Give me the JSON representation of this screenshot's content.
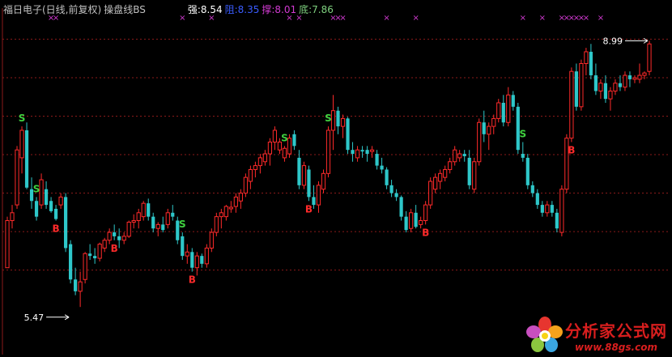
{
  "header": {
    "title": "福日电子(日线,前复权)",
    "indicator_name": "操盘线BS",
    "strong_label": "强:",
    "strong_value": "8.54",
    "resist_label": "阻:",
    "resist_value": "8.35",
    "support_label": "撑:",
    "support_value": "8.01",
    "bottom_label": "底:",
    "bottom_value": "7.86"
  },
  "colors": {
    "background": "#000000",
    "up": "#ff2a2a",
    "down": "#2ec7c9",
    "signal_s": "#3fd13f",
    "signal_b": "#ff2a2a",
    "x_marker": "#d23ad2",
    "grid": "#8b1a1a",
    "title": "#c0c0c0",
    "indicator": "#c0c0c0",
    "strong": "#ffffff",
    "resist": "#3a5cff",
    "support": "#d23ad2",
    "bottom": "#7fd17f"
  },
  "watermark": {
    "text": "分析家公式网",
    "url": "www.88gs.com",
    "logo_icon": "flower-logo-icon"
  },
  "chart_data": {
    "type": "candlestick",
    "ylim": [
      5.2,
      9.2
    ],
    "grid_levels": [
      6.07,
      6.56,
      7.05,
      7.54,
      8.03,
      8.52,
      9.01
    ],
    "candles": [
      [
        6.1,
        6.75,
        6.1,
        6.7
      ],
      [
        6.7,
        6.9,
        6.6,
        6.8
      ],
      [
        6.9,
        7.65,
        6.85,
        7.6
      ],
      [
        7.5,
        7.9,
        7.3,
        7.85
      ],
      [
        7.85,
        7.95,
        7.1,
        7.12
      ],
      [
        7.1,
        7.25,
        6.85,
        6.95
      ],
      [
        6.95,
        7.0,
        6.7,
        6.75
      ],
      [
        6.9,
        7.3,
        6.85,
        7.22
      ],
      [
        7.1,
        7.2,
        6.85,
        6.9
      ],
      [
        6.95,
        7.0,
        6.8,
        6.82
      ],
      [
        6.85,
        6.9,
        6.7,
        6.72
      ],
      [
        6.9,
        7.05,
        6.85,
        7.0
      ],
      [
        7.0,
        7.05,
        6.3,
        6.35
      ],
      [
        6.4,
        6.45,
        5.9,
        5.95
      ],
      [
        5.95,
        6.1,
        5.75,
        5.8
      ],
      [
        5.8,
        6.05,
        5.6,
        5.92
      ],
      [
        5.95,
        6.3,
        5.9,
        6.28
      ],
      [
        6.28,
        6.4,
        6.2,
        6.25
      ],
      [
        6.25,
        6.35,
        6.15,
        6.22
      ],
      [
        6.22,
        6.42,
        6.18,
        6.4
      ],
      [
        6.35,
        6.48,
        6.3,
        6.45
      ],
      [
        6.45,
        6.6,
        6.4,
        6.55
      ],
      [
        6.55,
        6.65,
        6.45,
        6.5
      ],
      [
        6.5,
        6.6,
        6.35,
        6.45
      ],
      [
        6.45,
        6.55,
        6.4,
        6.5
      ],
      [
        6.5,
        6.7,
        6.48,
        6.68
      ],
      [
        6.68,
        6.78,
        6.6,
        6.7
      ],
      [
        6.7,
        6.85,
        6.6,
        6.8
      ],
      [
        6.75,
        6.95,
        6.7,
        6.92
      ],
      [
        6.92,
        6.98,
        6.7,
        6.75
      ],
      [
        6.75,
        6.8,
        6.55,
        6.6
      ],
      [
        6.6,
        6.68,
        6.5,
        6.65
      ],
      [
        6.65,
        6.75,
        6.55,
        6.58
      ],
      [
        6.65,
        6.85,
        6.6,
        6.8
      ],
      [
        6.8,
        6.9,
        6.7,
        6.75
      ],
      [
        6.7,
        6.75,
        6.4,
        6.45
      ],
      [
        6.5,
        6.55,
        6.2,
        6.25
      ],
      [
        6.25,
        6.4,
        6.15,
        6.3
      ],
      [
        6.3,
        6.35,
        6.05,
        6.1
      ],
      [
        6.1,
        6.3,
        6.0,
        6.25
      ],
      [
        6.25,
        6.28,
        6.1,
        6.15
      ],
      [
        6.15,
        6.4,
        6.1,
        6.35
      ],
      [
        6.35,
        6.6,
        6.3,
        6.55
      ],
      [
        6.55,
        6.8,
        6.5,
        6.75
      ],
      [
        6.75,
        6.85,
        6.6,
        6.8
      ],
      [
        6.75,
        6.9,
        6.7,
        6.88
      ],
      [
        6.85,
        6.95,
        6.8,
        6.87
      ],
      [
        6.88,
        7.05,
        6.8,
        7.0
      ],
      [
        6.95,
        7.1,
        6.85,
        7.05
      ],
      [
        7.05,
        7.3,
        7.0,
        7.25
      ],
      [
        7.2,
        7.4,
        7.1,
        7.35
      ],
      [
        7.35,
        7.45,
        7.25,
        7.4
      ],
      [
        7.4,
        7.55,
        7.3,
        7.5
      ],
      [
        7.45,
        7.6,
        7.4,
        7.55
      ],
      [
        7.55,
        7.75,
        7.4,
        7.7
      ],
      [
        7.7,
        7.9,
        7.6,
        7.85
      ],
      [
        7.6,
        7.75,
        7.55,
        7.7
      ],
      [
        7.5,
        7.65,
        7.45,
        7.62
      ],
      [
        7.55,
        7.8,
        7.5,
        7.75
      ],
      [
        7.8,
        7.85,
        7.6,
        7.65
      ],
      [
        7.5,
        7.6,
        7.1,
        7.15
      ],
      [
        7.15,
        7.45,
        7.1,
        7.4
      ],
      [
        7.35,
        7.4,
        6.95,
        7.0
      ],
      [
        7.0,
        7.15,
        6.85,
        6.9
      ],
      [
        6.9,
        7.2,
        6.8,
        7.15
      ],
      [
        7.1,
        7.35,
        7.05,
        7.3
      ],
      [
        7.3,
        7.9,
        7.25,
        7.85
      ],
      [
        7.85,
        8.3,
        7.6,
        8.1
      ],
      [
        8.1,
        8.15,
        7.8,
        7.9
      ],
      [
        7.9,
        8.05,
        7.75,
        8.0
      ],
      [
        8.0,
        8.02,
        7.55,
        7.6
      ],
      [
        7.6,
        7.7,
        7.45,
        7.55
      ],
      [
        7.5,
        7.65,
        7.45,
        7.6
      ],
      [
        7.6,
        7.65,
        7.5,
        7.58
      ],
      [
        7.6,
        7.65,
        7.45,
        7.55
      ],
      [
        7.58,
        7.65,
        7.5,
        7.6
      ],
      [
        7.55,
        7.6,
        7.35,
        7.4
      ],
      [
        7.4,
        7.5,
        7.3,
        7.35
      ],
      [
        7.35,
        7.38,
        7.1,
        7.15
      ],
      [
        7.15,
        7.22,
        7.0,
        7.05
      ],
      [
        7.05,
        7.1,
        6.95,
        7.0
      ],
      [
        7.0,
        7.02,
        6.7,
        6.75
      ],
      [
        6.75,
        6.82,
        6.55,
        6.58
      ],
      [
        6.6,
        6.85,
        6.55,
        6.8
      ],
      [
        6.8,
        6.9,
        6.6,
        6.62
      ],
      [
        6.65,
        6.75,
        6.6,
        6.7
      ],
      [
        6.7,
        6.95,
        6.65,
        6.9
      ],
      [
        6.9,
        7.25,
        6.85,
        7.2
      ],
      [
        7.1,
        7.3,
        7.05,
        7.25
      ],
      [
        7.2,
        7.35,
        7.1,
        7.3
      ],
      [
        7.25,
        7.4,
        7.2,
        7.35
      ],
      [
        7.35,
        7.5,
        7.3,
        7.45
      ],
      [
        7.45,
        7.65,
        7.4,
        7.6
      ],
      [
        7.5,
        7.6,
        7.45,
        7.55
      ],
      [
        7.55,
        7.6,
        7.45,
        7.52
      ],
      [
        7.5,
        7.6,
        7.1,
        7.15
      ],
      [
        7.1,
        7.5,
        7.05,
        7.45
      ],
      [
        7.45,
        8.0,
        7.4,
        7.95
      ],
      [
        7.95,
        8.1,
        7.7,
        7.8
      ],
      [
        7.8,
        7.95,
        7.6,
        7.9
      ],
      [
        7.9,
        8.05,
        7.8,
        8.0
      ],
      [
        8.0,
        8.25,
        7.95,
        8.2
      ],
      [
        8.2,
        8.3,
        7.9,
        7.95
      ],
      [
        7.95,
        8.4,
        7.9,
        8.3
      ],
      [
        8.3,
        8.35,
        8.1,
        8.15
      ],
      [
        8.15,
        8.2,
        7.55,
        7.6
      ],
      [
        7.55,
        7.7,
        7.45,
        7.5
      ],
      [
        7.5,
        7.55,
        7.1,
        7.15
      ],
      [
        7.15,
        7.2,
        7.0,
        7.05
      ],
      [
        7.05,
        7.1,
        6.85,
        6.9
      ],
      [
        6.9,
        6.95,
        6.75,
        6.8
      ],
      [
        6.8,
        6.95,
        6.75,
        6.9
      ],
      [
        6.9,
        6.95,
        6.75,
        6.8
      ],
      [
        6.8,
        6.85,
        6.55,
        6.6
      ],
      [
        6.55,
        7.15,
        6.5,
        7.1
      ],
      [
        7.1,
        7.8,
        7.05,
        7.75
      ],
      [
        7.75,
        8.65,
        7.7,
        8.6
      ],
      [
        8.6,
        8.7,
        8.1,
        8.15
      ],
      [
        8.15,
        8.75,
        8.1,
        8.7
      ],
      [
        8.7,
        8.9,
        8.55,
        8.85
      ],
      [
        8.85,
        8.95,
        8.5,
        8.55
      ],
      [
        8.55,
        8.7,
        8.3,
        8.35
      ],
      [
        8.35,
        8.5,
        8.25,
        8.45
      ],
      [
        8.45,
        8.55,
        8.2,
        8.25
      ],
      [
        8.25,
        8.4,
        8.1,
        8.35
      ],
      [
        8.35,
        8.5,
        8.3,
        8.45
      ],
      [
        8.45,
        8.55,
        8.35,
        8.4
      ],
      [
        8.4,
        8.6,
        8.35,
        8.55
      ],
      [
        8.55,
        8.6,
        8.4,
        8.5
      ],
      [
        8.5,
        8.55,
        8.45,
        8.52
      ],
      [
        8.5,
        8.7,
        8.45,
        8.55
      ],
      [
        8.55,
        8.6,
        8.5,
        8.58
      ],
      [
        8.6,
        8.99,
        8.55,
        8.95
      ]
    ],
    "signals": [
      {
        "label": "S",
        "index": 3
      },
      {
        "label": "S",
        "index": 6
      },
      {
        "label": "B",
        "index": 10
      },
      {
        "label": "B",
        "index": 22
      },
      {
        "label": "S",
        "index": 36
      },
      {
        "label": "B",
        "index": 38
      },
      {
        "label": "S",
        "index": 57
      },
      {
        "label": "B",
        "index": 62
      },
      {
        "label": "S",
        "index": 66
      },
      {
        "label": "B",
        "index": 86
      },
      {
        "label": "S",
        "index": 106
      },
      {
        "label": "B",
        "index": 116
      }
    ],
    "x_markers": [
      9,
      10,
      36,
      42,
      58,
      60,
      67,
      68,
      69,
      78,
      84,
      106,
      110,
      114,
      115,
      116,
      117,
      118,
      119,
      122
    ],
    "annotations": [
      {
        "text": "5.47",
        "index": 13,
        "value": 5.47,
        "side": "left"
      },
      {
        "text": "8.99",
        "index": 132,
        "value": 8.99,
        "side": "left"
      }
    ]
  }
}
